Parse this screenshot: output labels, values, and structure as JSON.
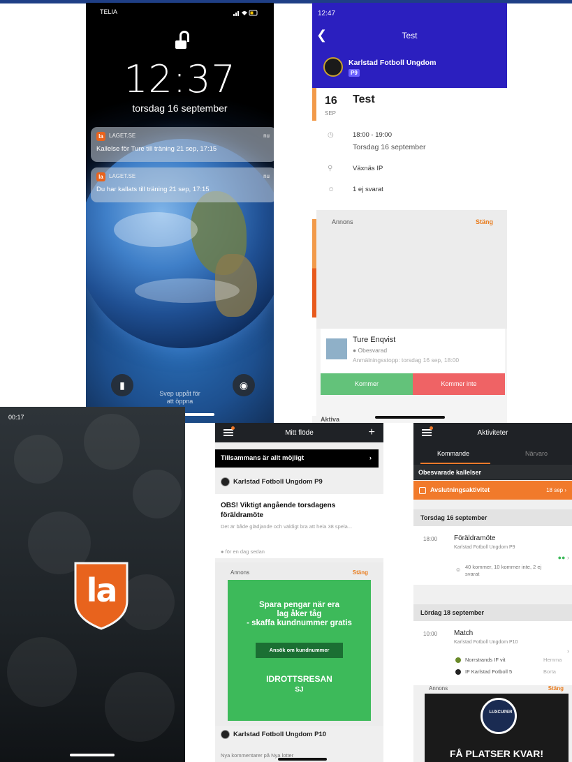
{
  "lock_screen": {
    "carrier": "TELIA",
    "time": "12:37",
    "date": "torsdag 16 september",
    "notifications": [
      {
        "app": "LAGET.SE",
        "time": "nu",
        "message": "Kallelse för Ture till träning 21 sep, 17:15"
      },
      {
        "app": "LAGET.SE",
        "time": "nu",
        "message": "Du har kallats till träning 21 sep, 17:15"
      }
    ],
    "swipe_text_1": "Svep uppåt för",
    "swipe_text_2": "att öppna",
    "icons": [
      "lock-open-icon",
      "flashlight-icon",
      "camera-icon"
    ]
  },
  "event_screen": {
    "status_time": "12:47",
    "nav_title": "Test",
    "club_name": "Karlstad Fotboll Ungdom",
    "team": "P9",
    "day": "16",
    "month": "SEP",
    "title": "Test",
    "time_range": "18:00 - 19:00",
    "date_text": "Torsdag 16 september",
    "location": "Växnäs IP",
    "responses": "1 ej svarat",
    "ad_label": "Annons",
    "ad_close": "Stäng",
    "player_name": "Ture Enqvist",
    "player_status": "Obesvarad",
    "deadline": "Anmälningsstopp: torsdag 16 sep, 18:00",
    "btn_yes": "Kommer",
    "btn_no": "Kommer inte",
    "section": "Aktiva",
    "colors": {
      "nav": "#2b1fbf",
      "yes": "#63c27a",
      "no": "#ef6365"
    }
  },
  "splash_screen": {
    "status_time": "00:17",
    "logo_text": "la"
  },
  "feed_screen": {
    "title": "Mitt flöde",
    "banner": "Tillsammans är allt möjligt",
    "club1": "Karlstad Fotboll Ungdom P9",
    "post_title": "OBS! Viktigt angående torsdagens föräldramöte",
    "post_body": "Det är både glädjande och väldigt bra att hela 38 spela...",
    "post_time": "för en dag sedan",
    "ad_label": "Annons",
    "ad_close": "Stäng",
    "ad_headline_1": "Spara pengar när era",
    "ad_headline_2": "lag åker tåg",
    "ad_headline_3": "- skaffa kundnummer gratis",
    "ad_cta": "Ansök om kundnummer",
    "ad_brand": "IDROTTSRESAN",
    "ad_brand2": "SJ",
    "club2": "Karlstad Fotboll Ungdom P10",
    "footer": "Nya kommentarer på Nya lotter"
  },
  "activities_screen": {
    "title": "Aktiviteter",
    "tab_upcoming": "Kommande",
    "tab_attendance": "Närvaro",
    "unanswered_header": "Obesvarade kallelser",
    "pending_name": "Avslutningsaktivitet",
    "pending_date": "18 sep",
    "day1": "Torsdag 16 september",
    "ev1_time": "18:00",
    "ev1_name": "Föräldramöte",
    "ev1_club": "Karlstad Fotboll Ungdom P9",
    "ev1_summary": "40 kommer, 10 kommer inte, 2 ej svarat",
    "day2": "Lördag 18 september",
    "ev2_time": "10:00",
    "ev2_name": "Match",
    "ev2_club": "Karlstad Fotboll Ungdom P10",
    "home_team": "Norrstrands IF vit",
    "home_label": "Hemma",
    "away_team": "IF Karlstad Fotboll 5",
    "away_label": "Borta",
    "ad_label": "Annons",
    "ad_close": "Stäng",
    "ad_logo": "LUXCUPER",
    "ad_text": "FÅ PLATSER KVAR!"
  }
}
